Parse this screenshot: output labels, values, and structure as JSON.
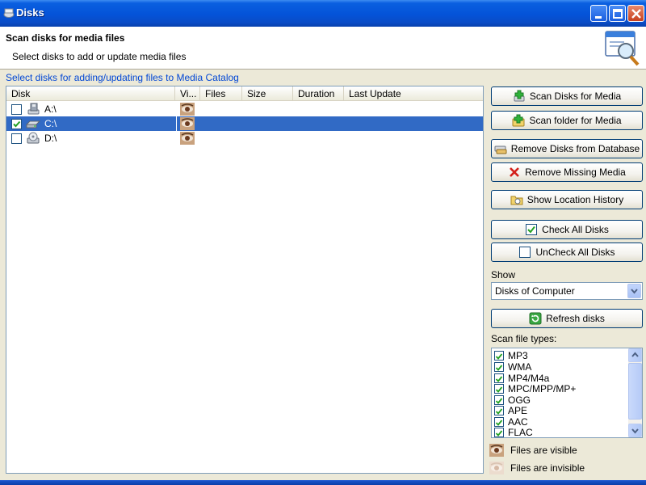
{
  "window": {
    "title": "Disks"
  },
  "header": {
    "title": "Scan disks for media files",
    "subtitle": "Select disks to add or update media files"
  },
  "group_label": "Select disks for adding/updating files to Media Catalog",
  "disk_list": {
    "columns": [
      "Disk",
      "Vi...",
      "Files",
      "Size",
      "Duration",
      "Last Update"
    ],
    "rows": [
      {
        "label": "A:\\",
        "checked": false,
        "selected": false,
        "icon": "floppy-drive-icon"
      },
      {
        "label": "C:\\",
        "checked": true,
        "selected": true,
        "icon": "hard-drive-icon"
      },
      {
        "label": "D:\\",
        "checked": false,
        "selected": false,
        "icon": "cd-drive-icon"
      }
    ]
  },
  "buttons": {
    "scan_disks": "Scan Disks for Media",
    "scan_folder": "Scan folder for Media",
    "remove_disks": "Remove Disks from Database",
    "remove_missing": "Remove Missing Media",
    "show_history": "Show Location History",
    "check_all": "Check All Disks",
    "uncheck_all": "UnCheck All Disks",
    "refresh": "Refresh disks"
  },
  "show": {
    "label": "Show",
    "value": "Disks of Computer"
  },
  "file_types": {
    "label": "Scan file types:",
    "items": [
      {
        "label": "MP3",
        "checked": true
      },
      {
        "label": "WMA",
        "checked": true
      },
      {
        "label": "MP4/M4a",
        "checked": true
      },
      {
        "label": "MPC/MPP/MP+",
        "checked": true
      },
      {
        "label": "OGG",
        "checked": true
      },
      {
        "label": "APE",
        "checked": true
      },
      {
        "label": "AAC",
        "checked": true
      },
      {
        "label": "FLAC",
        "checked": true
      }
    ]
  },
  "legend": {
    "visible": "Files are visible",
    "invisible": "Files are invisible"
  },
  "colors": {
    "selection": "#316ac5",
    "group_label": "#0046d5",
    "check_mark": "#21a121"
  }
}
